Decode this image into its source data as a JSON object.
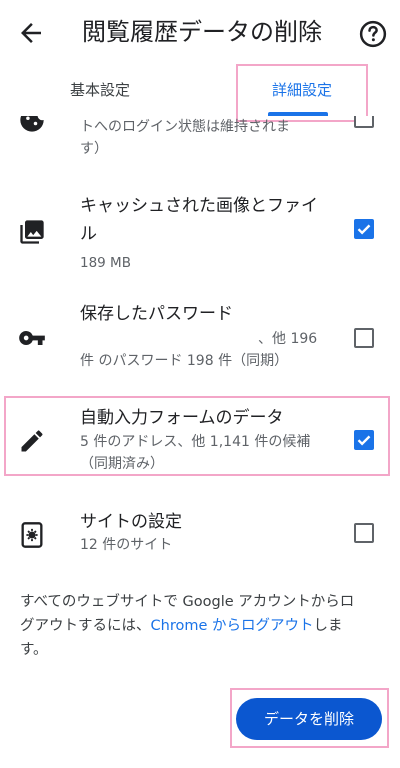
{
  "appbar": {
    "title": "閲覧履歴データの削除"
  },
  "tabs": {
    "basic": "基本設定",
    "advanced": "詳細設定"
  },
  "rows": {
    "cookies_partial": "トへのログイン状態は維持されま",
    "cookies_partial2": "す）",
    "cache": {
      "title1": "キャッシュされた画像とファイ",
      "title2": "ル",
      "sub": "189 MB",
      "checked": true
    },
    "passwords": {
      "title": "保存したパスワード",
      "sub1": "、他 196",
      "sub2": "件 のパスワード 198 件（同期）",
      "checked": false
    },
    "autofill": {
      "title": "自動入力フォームのデータ",
      "sub1": "5 件のアドレス、他 1,141 件の候補",
      "sub2": "（同期済み）",
      "checked": true
    },
    "site_settings": {
      "title": "サイトの設定",
      "sub": "12 件のサイト",
      "checked": false
    }
  },
  "footer": {
    "line1": "すべてのウェブサイトで Google アカウントからロ",
    "line2_pre": "グアウトするには、",
    "line2_link": "Chrome からログアウト",
    "line2_post": "しま",
    "line3": "す。"
  },
  "actions": {
    "delete": "データを削除"
  },
  "colors": {
    "accent": "#1a73e8",
    "button": "#0b57d0",
    "highlight": "#f3a6c8"
  }
}
